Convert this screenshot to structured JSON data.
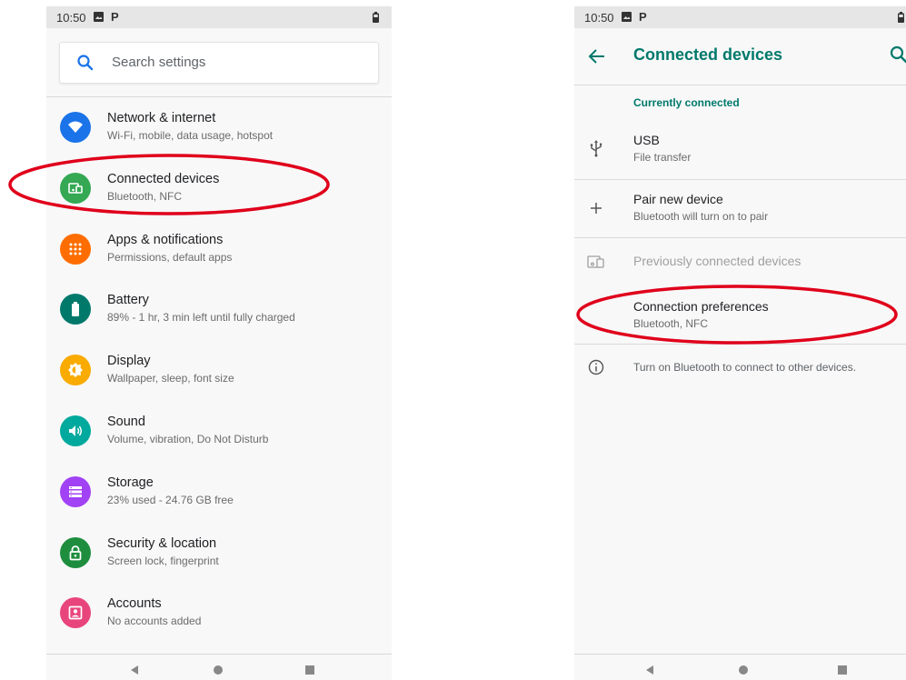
{
  "left_screen": {
    "status_time": "10:50",
    "status_p": "P",
    "search_placeholder": "Search settings",
    "items": [
      {
        "title": "Network & internet",
        "sub": "Wi-Fi, mobile, data usage, hotspot",
        "icon": "wifi-icon",
        "color": "#1a73e8"
      },
      {
        "title": "Connected devices",
        "sub": "Bluetooth, NFC",
        "icon": "devices-icon",
        "color": "#34a853"
      },
      {
        "title": "Apps & notifications",
        "sub": "Permissions, default apps",
        "icon": "apps-icon",
        "color": "#ff6d00"
      },
      {
        "title": "Battery",
        "sub": "89% - 1 hr, 3 min left until fully charged",
        "icon": "battery-icon",
        "color": "#00796b"
      },
      {
        "title": "Display",
        "sub": "Wallpaper, sleep, font size",
        "icon": "brightness-icon",
        "color": "#f9ab00"
      },
      {
        "title": "Sound",
        "sub": "Volume, vibration, Do Not Disturb",
        "icon": "volume-icon",
        "color": "#00a99d"
      },
      {
        "title": "Storage",
        "sub": "23% used - 24.76 GB free",
        "icon": "storage-icon",
        "color": "#a142f4"
      },
      {
        "title": "Security & location",
        "sub": "Screen lock, fingerprint",
        "icon": "lock-icon",
        "color": "#1e8e3e"
      },
      {
        "title": "Accounts",
        "sub": "No accounts added",
        "icon": "account-icon",
        "color": "#e8457c"
      }
    ]
  },
  "right_screen": {
    "status_time": "10:50",
    "status_p": "P",
    "title": "Connected devices",
    "section_header": "Currently connected",
    "usb_title": "USB",
    "usb_sub": "File transfer",
    "pair_title": "Pair new device",
    "pair_sub": "Bluetooth will turn on to pair",
    "previous_title": "Previously connected devices",
    "prefs_title": "Connection preferences",
    "prefs_sub": "Bluetooth, NFC",
    "info_text": "Turn on Bluetooth to connect to other devices."
  },
  "colors": {
    "accent": "#00796b",
    "annotation": "#e0001b"
  }
}
